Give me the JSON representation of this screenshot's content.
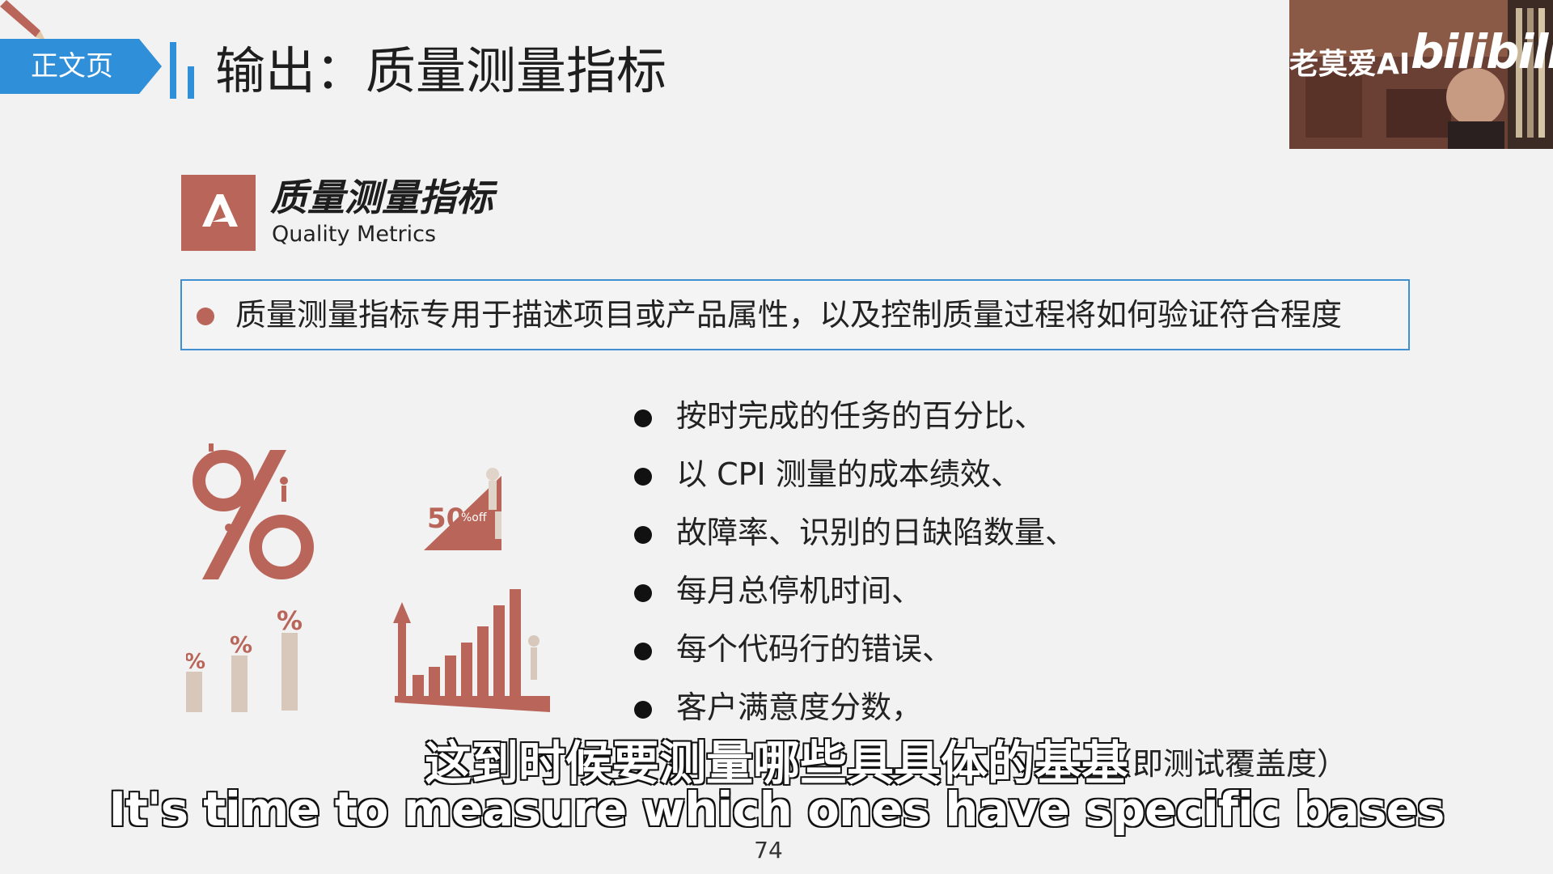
{
  "header": {
    "tag_label": "正文页",
    "title": "输出：质量测量指标",
    "tag_color": "#2f8fd8",
    "bar_color": "#2f8fd8"
  },
  "video_overlay": {
    "caption": "老莫爱AI",
    "logo": "bilibili"
  },
  "section": {
    "logo_color": "#b9655a",
    "title": "质量测量指标",
    "subtitle": "Quality Metrics"
  },
  "summary": {
    "text": "质量测量指标专用于描述项目或产品属性，以及控制质量过程将如何验证符合程度",
    "border_color": "#3f8fd1",
    "bullet_color": "#b9655a"
  },
  "metrics": [
    "按时完成的任务的百分比、",
    "以 CPI 测量的成本绩效、",
    "故障率、识别的日缺陷数量、",
    "每月总停机时间、",
    "每个代码行的错误、",
    "客户满意度分数，"
  ],
  "metric_tail": "（即测试覆盖度）",
  "illustration": {
    "accent_color": "#b9655a",
    "icons": [
      "percent-figure-icon",
      "fifty-percent-off-icon",
      "percent-podium-icon",
      "rising-bar-chart-icon"
    ],
    "sale_text": "50",
    "sale_sub": "%off"
  },
  "subtitles": {
    "zh": "这到时候要测量哪些具具体的基基",
    "en": "It's time to measure which ones have specific bases"
  },
  "page_number": "74"
}
